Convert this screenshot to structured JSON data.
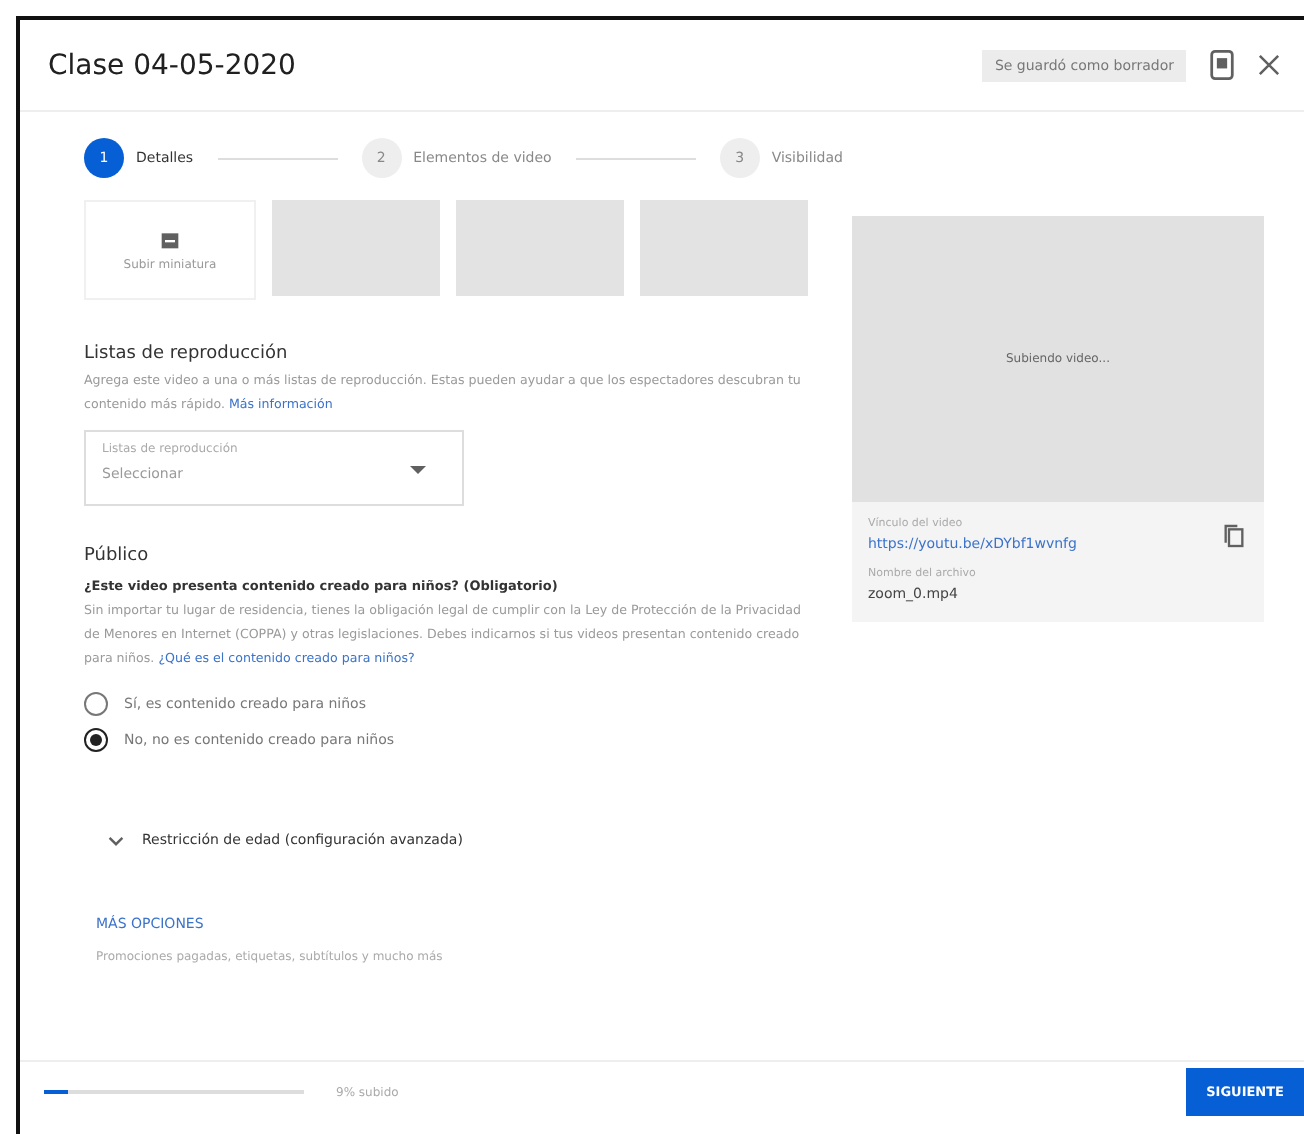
{
  "window": {
    "title": "Clase 04-05-2020",
    "save_status": "Se guardó como borrador"
  },
  "steps": [
    {
      "number": "1",
      "label": "Detalles",
      "selected": true
    },
    {
      "number": "2",
      "label": "Elementos de video",
      "selected": false
    },
    {
      "number": "3",
      "label": "Visibilidad",
      "selected": false
    }
  ],
  "thumbnails": {
    "upload_label": "Subir miniatura",
    "placeholders": [
      {
        "kind": "empty"
      },
      {
        "kind": "empty"
      },
      {
        "kind": "empty"
      }
    ]
  },
  "playlists": {
    "title": "Listas de reproducción",
    "description": "Agrega este video a una o más listas de reproducción. Estas pueden ayudar a que los espectadores descubran tu contenido más rápido.",
    "link": "Más información",
    "dropdown": {
      "label": "Listas de reproducción",
      "value": "Seleccionar"
    }
  },
  "audience": {
    "title": "Público",
    "question": "¿Este video presenta contenido creado para niños? (Obligatorio)",
    "description": "Sin importar tu lugar de residencia, tienes la obligación legal de cumplir con la Ley de Protección de la Privacidad de Menores en Internet (COPPA) y otras legislaciones. Debes indicarnos si tus videos presentan contenido creado para niños.",
    "link": "¿Qué es el contenido creado para niños?",
    "options": [
      {
        "label": "Sí, es contenido creado para niños",
        "selected": false
      },
      {
        "label": "No, no es contenido creado para niños",
        "selected": true
      }
    ]
  },
  "age_restriction": {
    "label": "Restricción de edad (configuración avanzada)",
    "expanded": false
  },
  "more_options": {
    "label": "MÁS OPCIONES",
    "description": "Promociones pagadas, etiquetas, subtítulos y mucho más"
  },
  "preview": {
    "status": "Subiendo video...",
    "link_label": "Vínculo del video",
    "link": "https://youtu.be/xDYbf1wvnfg",
    "file_label": "Nombre del archivo",
    "file": "zoom_0.mp4"
  },
  "footer": {
    "upload": {
      "level": 0.09,
      "reading": "9% subido"
    },
    "next_button": "SIGUIENTE"
  }
}
